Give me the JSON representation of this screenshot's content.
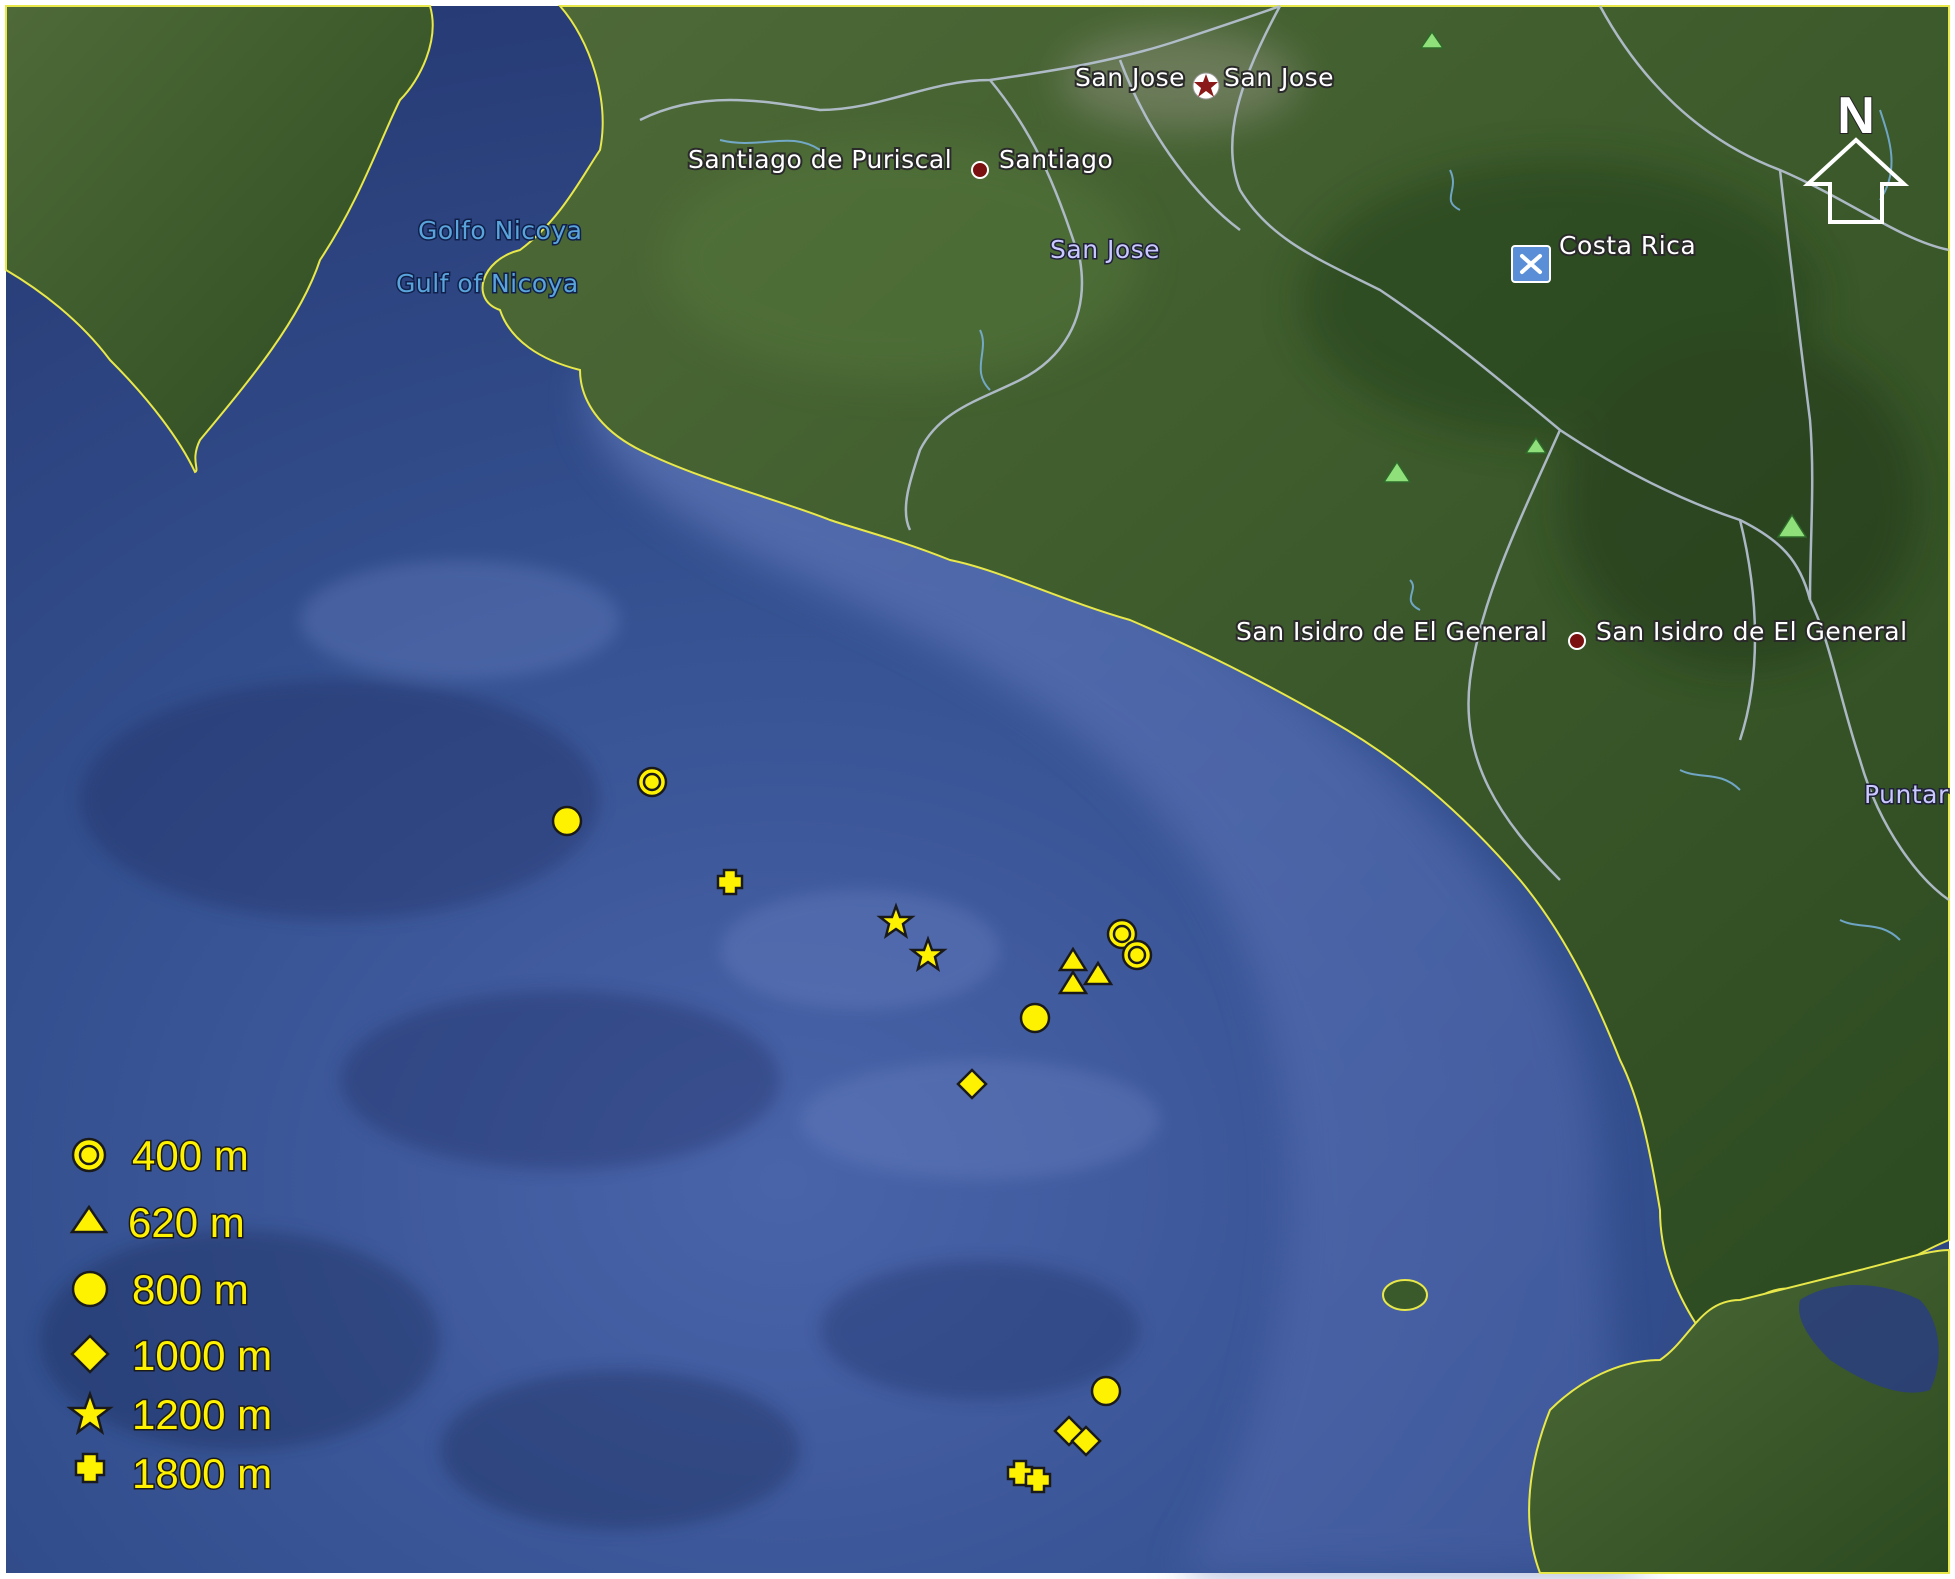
{
  "map": {
    "north_label": "N",
    "place_labels": {
      "san_jose_left": "San Jose",
      "san_jose_right": "San Jose",
      "santiago_de_puriscal": "Santiago de Puriscal",
      "santiago": "Santiago",
      "golfo_nicoya": "Golfo Nicoya",
      "gulf_of_nicoya": "Gulf of Nicoya",
      "san_jose_province": "San Jose",
      "costa_rica": "Costa Rica",
      "san_isidro_left": "San Isidro de El General",
      "san_isidro_right": "San Isidro de El General",
      "puntarenas_partial": "Puntar"
    },
    "colors": {
      "ocean": "#2d4486",
      "land": "#3d5a2c",
      "coastline": "#e8e84a",
      "border": "#b9c4d6",
      "marker_fill": "#fff200",
      "marker_stroke": "#1a1a1a",
      "peak_marker": "#8fe07a",
      "city_dot": "#7a1010"
    },
    "icons": {
      "capital": "star-icon",
      "city": "city-dot-icon",
      "country": "country-x-icon",
      "peak": "peak-triangle-icon",
      "north": "north-arrow-icon"
    }
  },
  "legend": [
    {
      "symbol": "ring-circle",
      "label": "400 m"
    },
    {
      "symbol": "triangle",
      "label": "620 m"
    },
    {
      "symbol": "circle",
      "label": "800 m"
    },
    {
      "symbol": "diamond",
      "label": "1000 m"
    },
    {
      "symbol": "star",
      "label": "1200 m"
    },
    {
      "symbol": "cross",
      "label": "1800 m"
    }
  ]
}
